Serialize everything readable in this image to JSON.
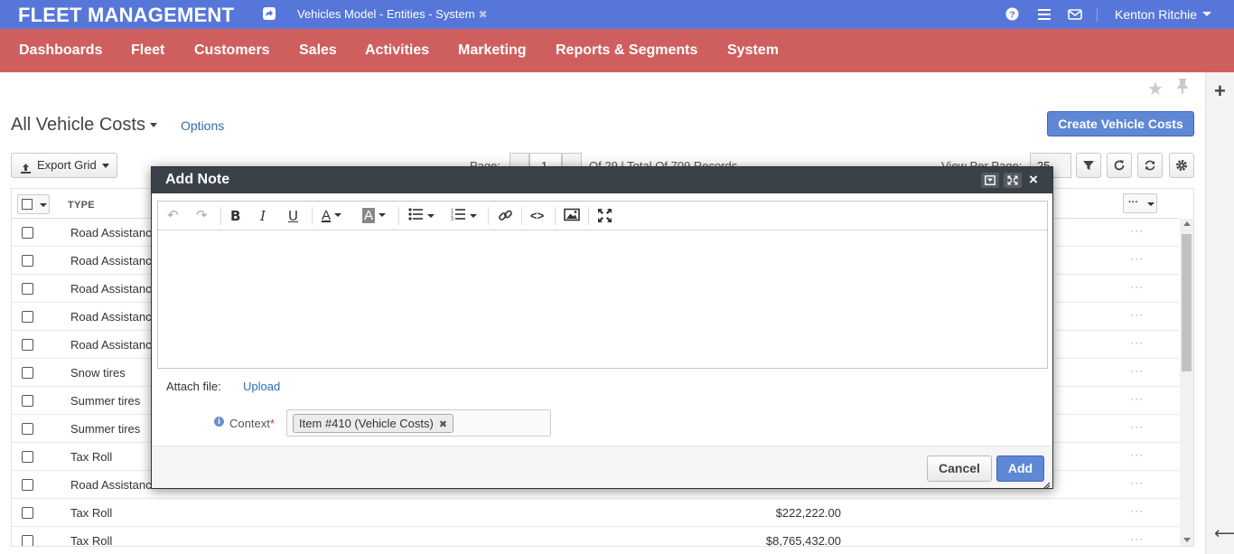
{
  "app": {
    "brand": "FLEET MANAGEMENT",
    "pinned_tab": "Vehicles Model - Entities - System",
    "user": "Kenton Ritchie",
    "colors": {
      "topbar": "#5677d9",
      "navbar": "#cf5f5f",
      "primary": "#5e87d6",
      "dialog_header": "#3b4149"
    }
  },
  "nav": {
    "items": [
      "Dashboards",
      "Fleet",
      "Customers",
      "Sales",
      "Activities",
      "Marketing",
      "Reports & Segments",
      "System"
    ]
  },
  "page": {
    "title": "All Vehicle Costs",
    "options": "Options",
    "create_button": "Create Vehicle Costs"
  },
  "grid_toolbar": {
    "export": "Export Grid",
    "page_label": "Page:",
    "page_value": "1",
    "page_info": "Of 29 | Total Of 709 Records",
    "view_per_page_label": "View Per Page:",
    "view_per_page_value": "25"
  },
  "grid": {
    "header": {
      "type": "TYPE",
      "actions": "···"
    },
    "rows": [
      {
        "type": "Road Assistance",
        "amount": ""
      },
      {
        "type": "Road Assistance",
        "amount": ""
      },
      {
        "type": "Road Assistance",
        "amount": ""
      },
      {
        "type": "Road Assistance",
        "amount": ""
      },
      {
        "type": "Road Assistance",
        "amount": ""
      },
      {
        "type": "Snow tires",
        "amount": ""
      },
      {
        "type": "Summer tires",
        "amount": ""
      },
      {
        "type": "Summer tires",
        "amount": ""
      },
      {
        "type": "Tax Roll",
        "amount": ""
      },
      {
        "type": "Road Assistance",
        "amount": ""
      },
      {
        "type": "Tax Roll",
        "amount": "$222,222.00"
      },
      {
        "type": "Tax Roll",
        "amount": "$8,765,432.00"
      }
    ],
    "row_action": "···"
  },
  "dialog": {
    "title": "Add Note",
    "attach_label": "Attach file:",
    "upload": "Upload",
    "context_label": "Context",
    "context_required": "*",
    "context_tag": "Item #410 (Vehicle Costs)",
    "cancel": "Cancel",
    "add": "Add"
  }
}
